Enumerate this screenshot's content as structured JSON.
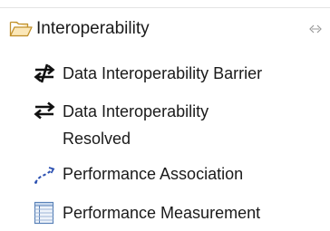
{
  "drawer": {
    "label": "Interoperability",
    "folder_icon": "open-folder-icon",
    "collapse_icon": "collapse-arrows-icon",
    "colors": {
      "folder_fill": "#fbe7b8",
      "folder_stroke": "#c0902b"
    }
  },
  "tools": [
    {
      "label": "Data Interoperability Barrier",
      "icon": "barrier-arrows-icon"
    },
    {
      "label": "Data Interoperability Resolved",
      "icon": "resolved-arrows-icon"
    },
    {
      "label": "Performance Association",
      "icon": "dashed-association-icon",
      "color": "#2a4fb0"
    },
    {
      "label": "Performance Measurement",
      "icon": "measurement-table-icon",
      "color": "#5a82b8"
    }
  ]
}
